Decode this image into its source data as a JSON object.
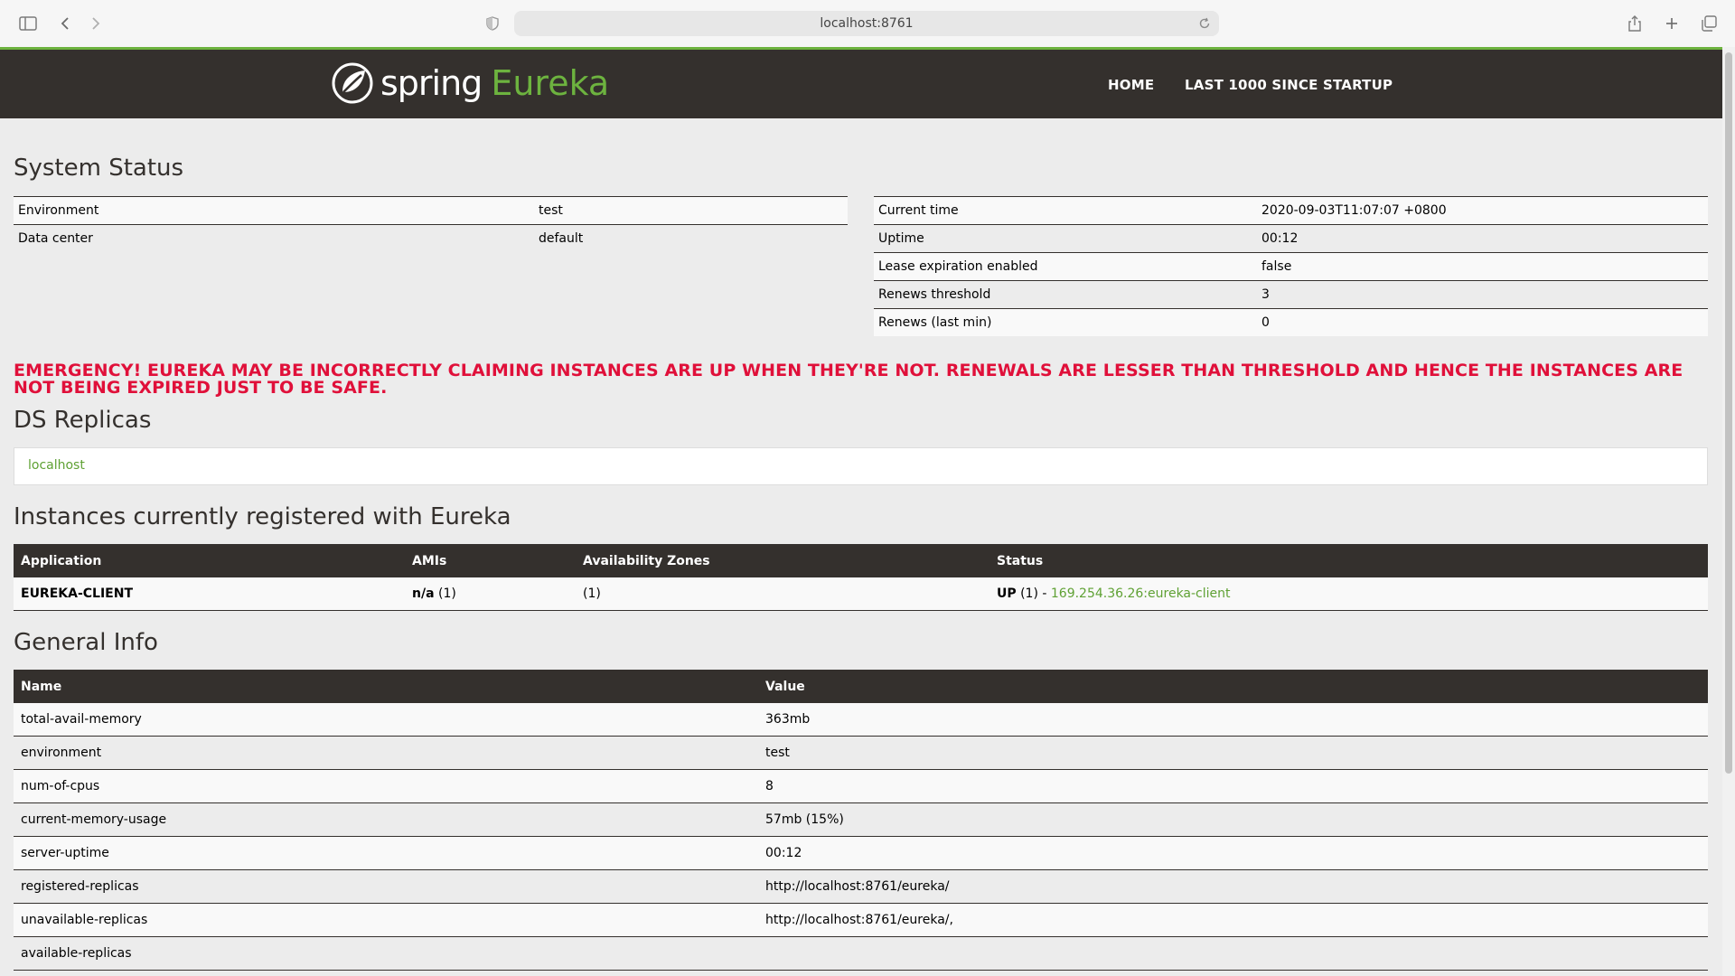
{
  "browser": {
    "url": "localhost:8761"
  },
  "nav": {
    "brand_spring": "spring",
    "brand_eureka": "Eureka",
    "home": "HOME",
    "last1000": "LAST 1000 SINCE STARTUP"
  },
  "system_status": {
    "title": "System Status",
    "left": [
      {
        "label": "Environment",
        "value": "test"
      },
      {
        "label": "Data center",
        "value": "default"
      }
    ],
    "right": [
      {
        "label": "Current time",
        "value": "2020-09-03T11:07:07 +0800"
      },
      {
        "label": "Uptime",
        "value": "00:12"
      },
      {
        "label": "Lease expiration enabled",
        "value": "false"
      },
      {
        "label": "Renews threshold",
        "value": "3"
      },
      {
        "label": "Renews (last min)",
        "value": "0"
      }
    ]
  },
  "emergency": "EMERGENCY! EUREKA MAY BE INCORRECTLY CLAIMING INSTANCES ARE UP WHEN THEY'RE NOT. RENEWALS ARE LESSER THAN THRESHOLD AND HENCE THE INSTANCES ARE NOT BEING EXPIRED JUST TO BE SAFE.",
  "replicas": {
    "title": "DS Replicas",
    "link": "localhost"
  },
  "instances": {
    "title": "Instances currently registered with Eureka",
    "headers": [
      "Application",
      "AMIs",
      "Availability Zones",
      "Status"
    ],
    "rows": [
      {
        "application": "EUREKA-CLIENT",
        "amis_bold": "n/a",
        "amis_count": " (1)",
        "zones": "(1)",
        "status_bold": "UP",
        "status_count": " (1) - ",
        "status_link": "169.254.36.26:eureka-client"
      }
    ]
  },
  "general_info": {
    "title": "General Info",
    "headers": [
      "Name",
      "Value"
    ],
    "rows": [
      {
        "name": "total-avail-memory",
        "value": "363mb"
      },
      {
        "name": "environment",
        "value": "test"
      },
      {
        "name": "num-of-cpus",
        "value": "8"
      },
      {
        "name": "current-memory-usage",
        "value": "57mb (15%)"
      },
      {
        "name": "server-uptime",
        "value": "00:12"
      },
      {
        "name": "registered-replicas",
        "value": "http://localhost:8761/eureka/"
      },
      {
        "name": "unavailable-replicas",
        "value": "http://localhost:8761/eureka/,"
      },
      {
        "name": "available-replicas",
        "value": ""
      }
    ]
  }
}
